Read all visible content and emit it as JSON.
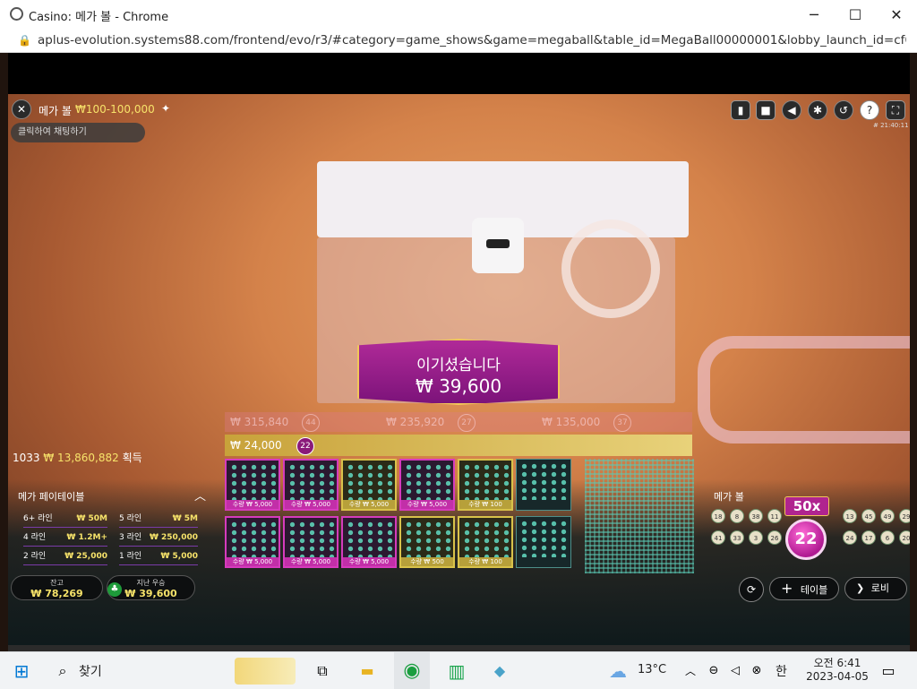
{
  "browser": {
    "window_title": "Casino: 메가 볼 - Chrome",
    "url": "aplus-evolution.systems88.com/frontend/evo/r3/#category=game_shows&game=megaball&table_id=MegaBall00000001&lobby_launch_id=cf676c50...",
    "minimize_glyph": "─",
    "maximize_glyph": "☐",
    "close_glyph": "✕"
  },
  "game": {
    "title": "메가 볼",
    "limits": "₩100-100,000",
    "chat_placeholder": "클릭하여 채팅하기",
    "round_id": "# 21:40:11",
    "win_banner": {
      "line1": "이기셨습니다",
      "line2": "₩ 39,600"
    },
    "winners": {
      "count": "1033",
      "amount": "₩ 13,860,882",
      "suffix": "획득"
    },
    "faded_cards": [
      {
        "amount": "₩ 315,840",
        "ball": "44"
      },
      {
        "amount": "₩ 235,920",
        "ball": "27"
      },
      {
        "amount": "₩ 135,000",
        "ball": "37"
      }
    ],
    "active_card": {
      "amount": "₩ 24,000",
      "ball": "22"
    },
    "card_rows": [
      [
        {
          "style": "magenta",
          "foot": "수량 ₩ 5,000"
        },
        {
          "style": "magenta",
          "foot": "수량 ₩ 5,000"
        },
        {
          "style": "gold",
          "foot": "수량 ₩ 5,000"
        },
        {
          "style": "magenta",
          "foot": "수량 ₩ 5,000"
        },
        {
          "style": "gold",
          "foot": "수량 ₩ 100"
        },
        {
          "style": "teal",
          "foot": ""
        }
      ],
      [
        {
          "style": "magenta",
          "foot": "수량 ₩ 5,000"
        },
        {
          "style": "magenta",
          "foot": "수량 ₩ 5,000"
        },
        {
          "style": "magenta",
          "foot": "수량 ₩ 5,000"
        },
        {
          "style": "gold",
          "foot": "수량 ₩ 500"
        },
        {
          "style": "gold",
          "foot": "수량 ₩ 100"
        },
        {
          "style": "teal",
          "foot": ""
        }
      ]
    ],
    "paytable": {
      "title": "메가 페이테이블",
      "rows": [
        {
          "label": "6+ 라인",
          "value": "₩ 50M"
        },
        {
          "label": "5 라인",
          "value": "₩ 5M"
        },
        {
          "label": "4 라인",
          "value": "₩ 1.2M+"
        },
        {
          "label": "3 라인",
          "value": "₩ 250,000"
        },
        {
          "label": "2 라인",
          "value": "₩ 25,000"
        },
        {
          "label": "1 라인",
          "value": "₩ 5,000"
        }
      ]
    },
    "balance": {
      "label": "잔고",
      "value": "₩ 78,269"
    },
    "last_win": {
      "label": "지난 우승",
      "value": "₩ 39,600"
    },
    "megaball_panel": {
      "title": "메가 볼",
      "multiplier": "50x",
      "ball": "22",
      "drawn_row1": [
        "18",
        "8",
        "38",
        "11",
        "",
        "",
        "",
        "13",
        "45",
        "49",
        "29"
      ],
      "drawn_row2": [
        "41",
        "33",
        "3",
        "26",
        "",
        "",
        "",
        "24",
        "17",
        "6",
        "20"
      ]
    },
    "buttons": {
      "table": "테이블",
      "lobby": "로비"
    },
    "icons": {
      "close": "✕",
      "star": "✦",
      "chat": "▮",
      "video": "■",
      "sound": "◀",
      "settings": "✱",
      "history": "↺",
      "help": "?",
      "fullscreen": "⛶",
      "rebet": "⟳",
      "plus": "+",
      "lobby": "❯",
      "chevron_up": "︿",
      "win": "♣"
    }
  },
  "taskbar": {
    "search_label": "찾기",
    "weather": "13°C",
    "ime": "한",
    "time": "오전 6:41",
    "date": "2023-04-05",
    "icons": {
      "start": "⊞",
      "search": "⌕",
      "taskview": "⧉",
      "explorer": "▬",
      "chrome": "◉",
      "chart_app": "▥",
      "notes": "◆",
      "weather": "☁",
      "tray_up": "︿",
      "tray_net": "⊖",
      "tray_volume": "◁",
      "tray_close": "⊗",
      "notification": "▭"
    }
  }
}
